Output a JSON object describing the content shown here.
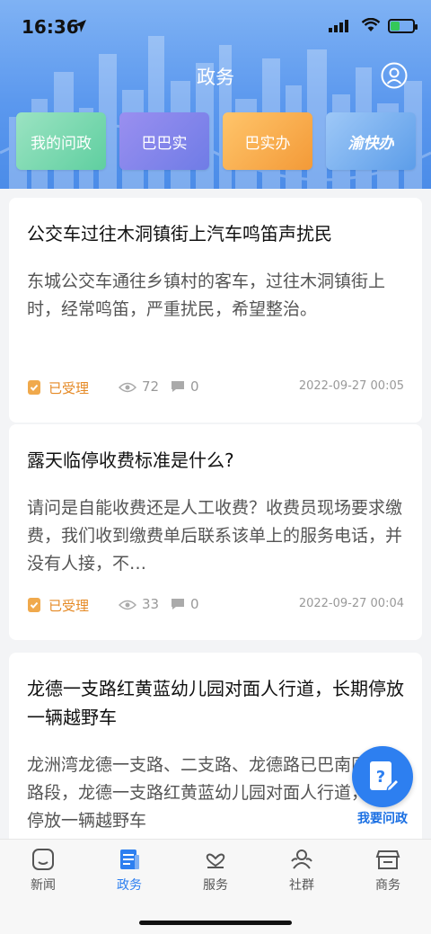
{
  "status_bar": {
    "time": "16:36"
  },
  "nav": {
    "title": "政务"
  },
  "tiles": [
    {
      "label": "我的问政"
    },
    {
      "label": "巴巴实"
    },
    {
      "label": "巴实办"
    },
    {
      "label": "渝快办"
    }
  ],
  "posts": [
    {
      "title": "公交车过往木洞镇街上汽车鸣笛声扰民",
      "body": "东城公交车通往乡镇村的客车，过往木洞镇街上时，经常鸣笛，严重扰民，希望整治。",
      "status": "已受理",
      "views": "72",
      "comments": "0",
      "datetime": "2022-09-27 00:05"
    },
    {
      "title": "露天临停收费标准是什么?",
      "body": "请问是自能收费还是人工收费？收费员现场要求缴费，我们收到缴费单后联系该单上的服务电话，并没有人接，不…",
      "status": "已受理",
      "views": "33",
      "comments": "0",
      "datetime": "2022-09-27 00:04"
    },
    {
      "title": "龙德一支路红黄蓝幼儿园对面人行道，长期停放一辆越野车",
      "body": "龙洲湾龙德一支路、二支路、龙德路已巴南区严管路段，龙德一支路红黄蓝幼儿园对面人行道，长期停放一辆越野车"
    }
  ],
  "fab": {
    "label": "我要问政"
  },
  "tabs": [
    {
      "label": "新闻"
    },
    {
      "label": "政务"
    },
    {
      "label": "服务"
    },
    {
      "label": "社群"
    },
    {
      "label": "商务"
    }
  ],
  "colors": {
    "accent": "#2d7ff0",
    "status": "#e58a26",
    "header": "#5b98ee"
  }
}
